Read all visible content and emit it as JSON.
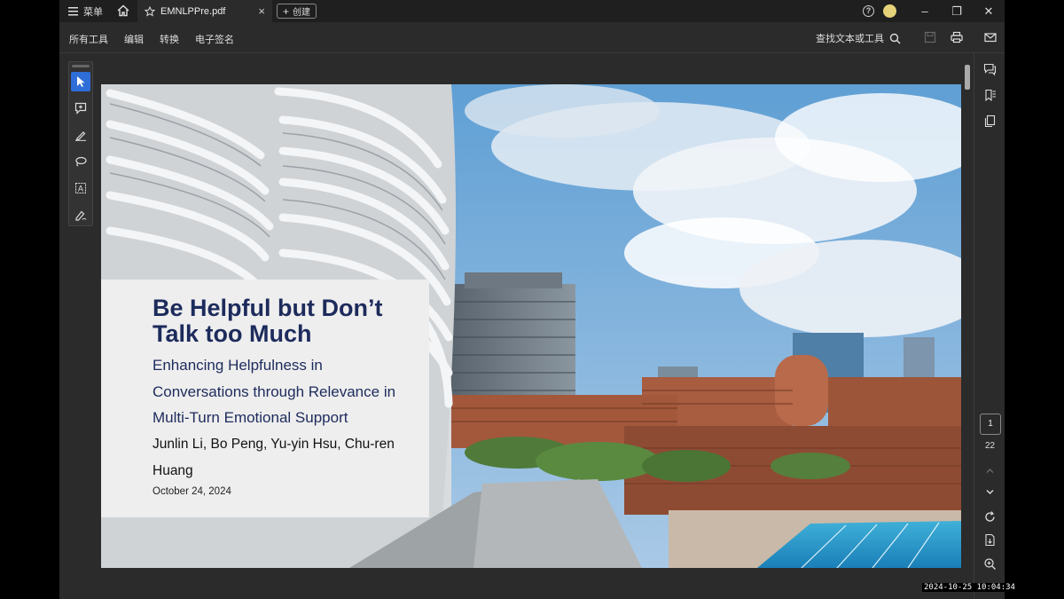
{
  "titlebar": {
    "menu_label": "菜单",
    "tab_title": "EMNLPPre.pdf",
    "new_tab_label": "创建",
    "help": "?"
  },
  "toolbar": {
    "items": [
      "所有工具",
      "编辑",
      "转换",
      "电子签名"
    ],
    "find_label": "查找文本或工具"
  },
  "slide": {
    "title": "Be Helpful but Don’t Talk too Much",
    "subtitle": "Enhancing Helpfulness in Conversations through Relevance in Multi-Turn Emotional Support",
    "authors": "Junlin Li, Bo Peng, Yu-yin Hsu, Chu-ren Huang",
    "date": "October 24, 2024"
  },
  "navigation": {
    "current_page": "1",
    "total_pages": "22"
  },
  "timestamp": "2024-10-25 10:04:34",
  "colors": {
    "accent": "#2f6dd9",
    "title_color": "#1d2b5c"
  }
}
